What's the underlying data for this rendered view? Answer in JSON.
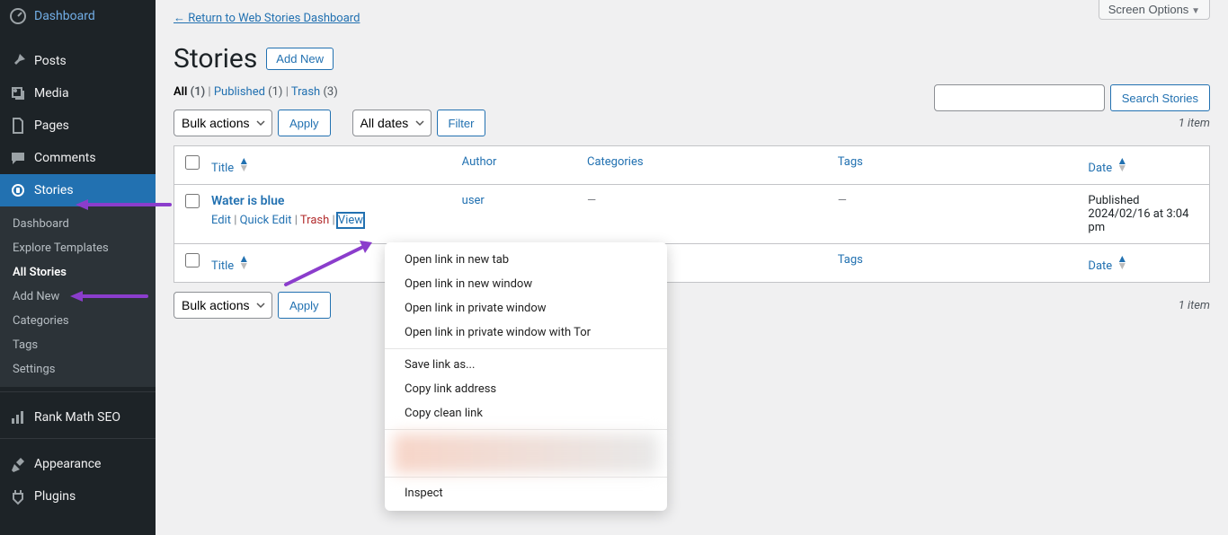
{
  "sidebar": {
    "dashboard": "Dashboard",
    "posts": "Posts",
    "media": "Media",
    "pages": "Pages",
    "comments": "Comments",
    "stories": "Stories",
    "rank_math": "Rank Math SEO",
    "appearance": "Appearance",
    "plugins": "Plugins",
    "sub": {
      "dashboard": "Dashboard",
      "explore_templates": "Explore Templates",
      "all_stories": "All Stories",
      "add_new": "Add New",
      "categories": "Categories",
      "tags": "Tags",
      "settings": "Settings"
    }
  },
  "screen_options": "Screen Options",
  "return_link": "← Return to Web Stories Dashboard",
  "page_title": "Stories",
  "add_new": "Add New",
  "filters": {
    "all_label": "All",
    "all_count": "(1)",
    "published_label": "Published",
    "published_count": "(1)",
    "trash_label": "Trash",
    "trash_count": "(3)"
  },
  "search_button": "Search Stories",
  "bulk_actions": "Bulk actions",
  "apply": "Apply",
  "all_dates": "All dates",
  "filter": "Filter",
  "item_count": "1 item",
  "columns": {
    "title": "Title",
    "author": "Author",
    "categories": "Categories",
    "tags": "Tags",
    "date": "Date"
  },
  "row": {
    "title": "Water is blue",
    "author": "user",
    "categories": "—",
    "tags": "—",
    "date_status": "Published",
    "date_value": "2024/02/16 at 3:04 pm",
    "actions": {
      "edit": "Edit",
      "quick_edit": "Quick Edit",
      "trash": "Trash",
      "view": "View"
    }
  },
  "context_menu": {
    "open_new_tab": "Open link in new tab",
    "open_new_window": "Open link in new window",
    "open_private": "Open link in private window",
    "open_private_tor": "Open link in private window with Tor",
    "save_link": "Save link as...",
    "copy_link": "Copy link address",
    "copy_clean": "Copy clean link",
    "inspect": "Inspect"
  }
}
